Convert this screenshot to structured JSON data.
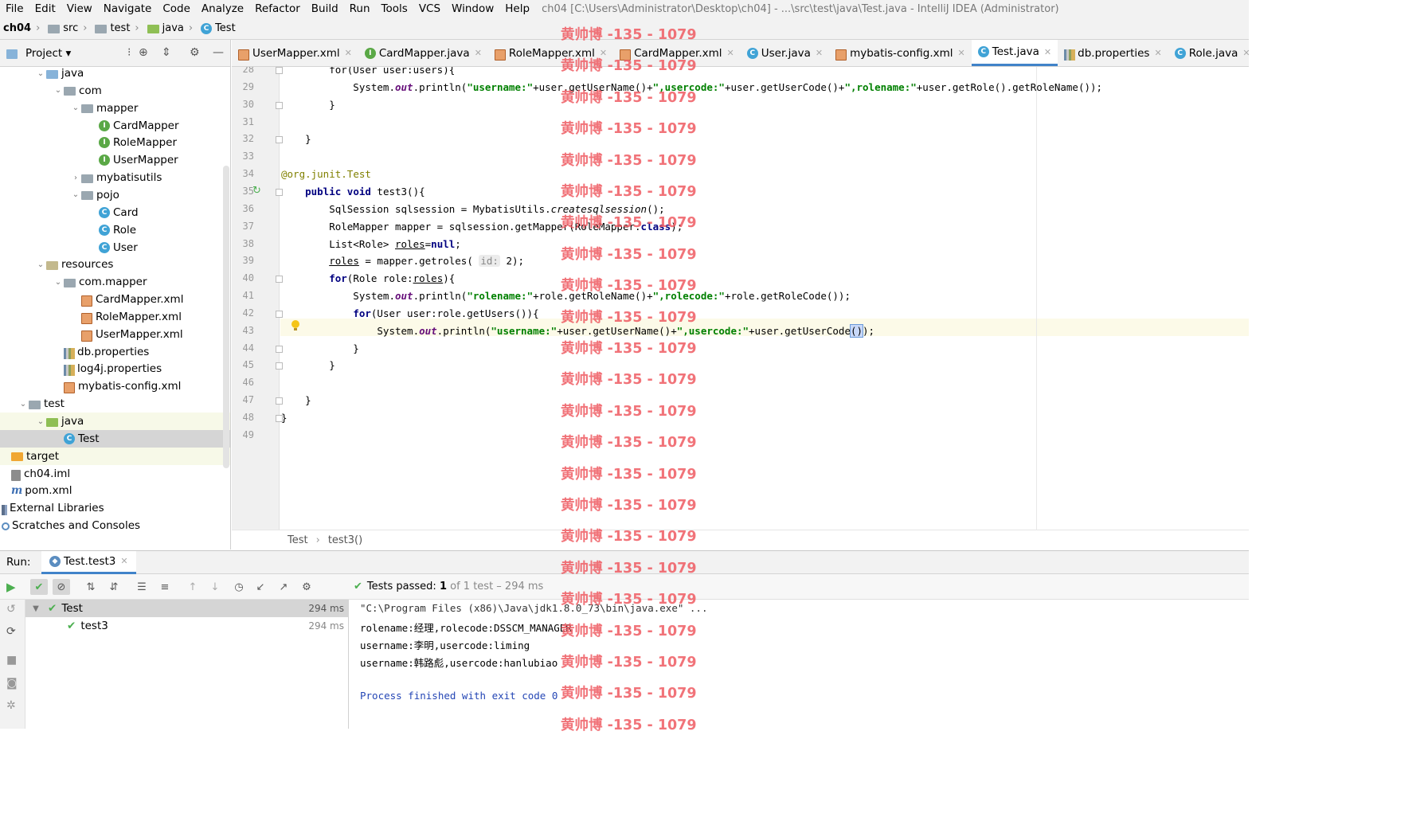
{
  "menu": {
    "items": [
      "File",
      "Edit",
      "View",
      "Navigate",
      "Code",
      "Analyze",
      "Refactor",
      "Build",
      "Run",
      "Tools",
      "VCS",
      "Window",
      "Help"
    ],
    "window_title": "ch04 [C:\\Users\\Administrator\\Desktop\\ch04] - ...\\src\\test\\java\\Test.java - IntelliJ IDEA (Administrator)"
  },
  "breadcrumb": [
    "ch04",
    "src",
    "test",
    "java",
    "Test"
  ],
  "project_panel": {
    "title": "Project",
    "tree": [
      {
        "label": "java",
        "indent": 2,
        "icon": "folder-blue",
        "arrow": "down"
      },
      {
        "label": "com",
        "indent": 3,
        "icon": "folder",
        "arrow": "down"
      },
      {
        "label": "mapper",
        "indent": 4,
        "icon": "folder",
        "arrow": "down"
      },
      {
        "label": "CardMapper",
        "indent": 5,
        "icon": "interface"
      },
      {
        "label": "RoleMapper",
        "indent": 5,
        "icon": "interface"
      },
      {
        "label": "UserMapper",
        "indent": 5,
        "icon": "interface"
      },
      {
        "label": "mybatisutils",
        "indent": 4,
        "icon": "folder",
        "arrow": "right"
      },
      {
        "label": "pojo",
        "indent": 4,
        "icon": "folder",
        "arrow": "down"
      },
      {
        "label": "Card",
        "indent": 5,
        "icon": "class"
      },
      {
        "label": "Role",
        "indent": 5,
        "icon": "class"
      },
      {
        "label": "User",
        "indent": 5,
        "icon": "class"
      },
      {
        "label": "resources",
        "indent": 2,
        "icon": "folder-res",
        "arrow": "down"
      },
      {
        "label": "com.mapper",
        "indent": 3,
        "icon": "folder",
        "arrow": "down"
      },
      {
        "label": "CardMapper.xml",
        "indent": 4,
        "icon": "xml"
      },
      {
        "label": "RoleMapper.xml",
        "indent": 4,
        "icon": "xml"
      },
      {
        "label": "UserMapper.xml",
        "indent": 4,
        "icon": "xml"
      },
      {
        "label": "db.properties",
        "indent": 3,
        "icon": "properties"
      },
      {
        "label": "log4j.properties",
        "indent": 3,
        "icon": "properties"
      },
      {
        "label": "mybatis-config.xml",
        "indent": 3,
        "icon": "xml"
      },
      {
        "label": "test",
        "indent": 1,
        "icon": "folder",
        "arrow": "down"
      },
      {
        "label": "java",
        "indent": 2,
        "icon": "folder-green",
        "arrow": "down",
        "state": "hl"
      },
      {
        "label": "Test",
        "indent": 3,
        "icon": "class",
        "state": "sel"
      },
      {
        "label": "target",
        "indent": 0,
        "icon": "folder-orange",
        "state": "hl"
      },
      {
        "label": "ch04.iml",
        "indent": 0,
        "icon": "iml"
      },
      {
        "label": "pom.xml",
        "indent": 0,
        "icon": "maven"
      },
      {
        "label": "External Libraries",
        "indent": -1,
        "icon": "library"
      },
      {
        "label": "Scratches and Consoles",
        "indent": -1,
        "icon": "scratch"
      }
    ]
  },
  "editor_tabs": [
    {
      "label": "UserMapper.xml",
      "icon": "xml"
    },
    {
      "label": "CardMapper.java",
      "icon": "interface"
    },
    {
      "label": "RoleMapper.xml",
      "icon": "xml"
    },
    {
      "label": "CardMapper.xml",
      "icon": "xml"
    },
    {
      "label": "User.java",
      "icon": "class"
    },
    {
      "label": "mybatis-config.xml",
      "icon": "xml"
    },
    {
      "label": "Test.java",
      "icon": "class",
      "active": true
    },
    {
      "label": "db.properties",
      "icon": "properties"
    },
    {
      "label": "Role.java",
      "icon": "class"
    }
  ],
  "line_numbers": [
    "28",
    "29",
    "30",
    "31",
    "32",
    "33",
    "34",
    "35",
    "36",
    "37",
    "38",
    "39",
    "40",
    "41",
    "42",
    "43",
    "44",
    "45",
    "46",
    "47",
    "48",
    "49"
  ],
  "code": {
    "l28": "        for(User user:users){",
    "l29_a": "            System.",
    "l29_out": "out",
    "l29_b": ".println(",
    "l29_s1": "\"username:\"",
    "l29_c": "+user.getUserName()+",
    "l29_s2": "\",usercode:\"",
    "l29_d": "+user.getUserCode()+",
    "l29_s3": "\",rolename:\"",
    "l29_e": "+user.getRole().getRoleName());",
    "l30": "        }",
    "l32": "    }",
    "l34_ann": "@org.junit.",
    "l34_test": "Test",
    "l35_kw1": "public",
    "l35_kw2": "void",
    "l35_rest": " test3(){",
    "l36_a": "        SqlSession sqlsession = MybatisUtils.",
    "l36_m": "createsqlsession",
    "l36_b": "();",
    "l37_a": "        RoleMapper mapper = sqlsession.getMapper(RoleMapper.",
    "l37_kw": "class",
    "l37_b": ");",
    "l38_a": "        List<Role> ",
    "l38_v": "roles",
    "l38_b": "=",
    "l38_kw": "null",
    "l38_c": ";",
    "l39_v": "roles",
    "l39_a": " = mapper.getroles( ",
    "l39_hint": "id:",
    "l39_b": " 2);",
    "l40_kw": "for",
    "l40_a": "(Role role:",
    "l40_v": "roles",
    "l40_b": "){",
    "l41_a": "            System.",
    "l41_out": "out",
    "l41_b": ".println(",
    "l41_s1": "\"rolename:\"",
    "l41_c": "+role.getRoleName()+",
    "l41_s2": "\",rolecode:\"",
    "l41_d": "+role.getRoleCode());",
    "l42_kw": "for",
    "l42_a": "(User user:role.getUsers()){",
    "l43_a": "                System.",
    "l43_out": "out",
    "l43_b": ".println(",
    "l43_s1": "\"username:\"",
    "l43_c": "+user.getUserName()+",
    "l43_s2": "\",usercode:\"",
    "l43_d": "+user.getUserCode",
    "l43_br": "()",
    "l43_e": ");",
    "l44": "            }",
    "l45": "        }",
    "l47": "    }",
    "l48": "}"
  },
  "editor_breadcrumb": [
    "Test",
    "test3()"
  ],
  "run": {
    "label": "Run:",
    "tab": "Test.test3",
    "status_prefix": "Tests passed:",
    "status_count": "1",
    "status_rest": "of 1 test – 294 ms",
    "tree": [
      {
        "label": "Test",
        "time": "294 ms"
      },
      {
        "label": "test3",
        "time": "294 ms"
      }
    ],
    "console": [
      "\"C:\\Program Files (x86)\\Java\\jdk1.8.0_73\\bin\\java.exe\" ...",
      "rolename:经理,rolecode:DSSCM_MANAGER",
      "username:李明,usercode:liming",
      "username:韩路彪,usercode:hanlubiao",
      "",
      "Process finished with exit code 0"
    ]
  },
  "watermark_text": "黄帅博 -135 - 1079",
  "colors": {
    "accent": "#4083c9",
    "string": "#008000",
    "keyword": "#000080",
    "watermark": "#ef5b62",
    "passed": "#4caf50"
  }
}
